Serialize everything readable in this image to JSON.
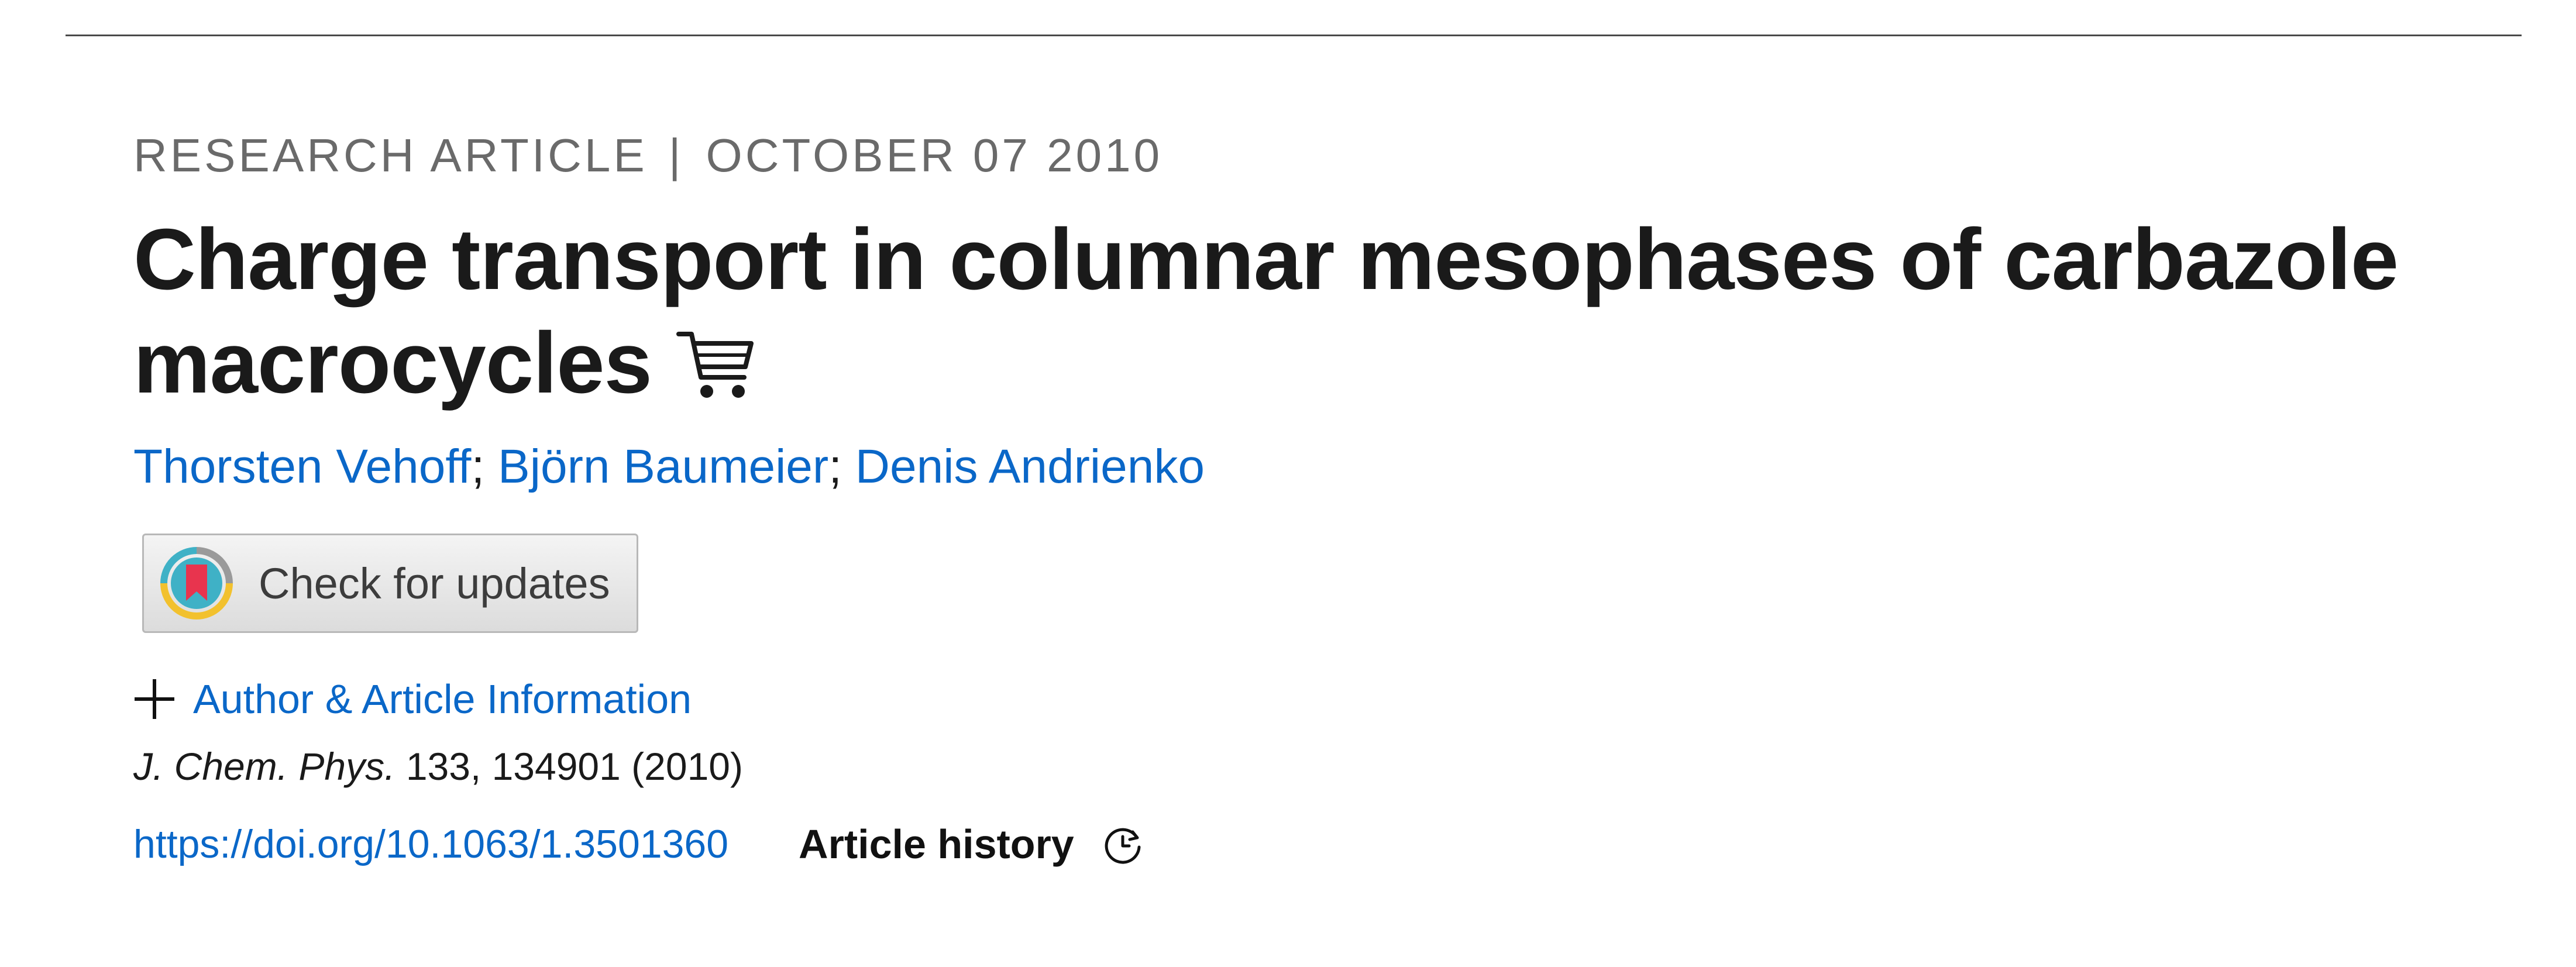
{
  "article": {
    "type": "RESEARCH ARTICLE",
    "separator": "|",
    "date": "OCTOBER 07 2010",
    "title": "Charge transport in columnar mesophases of carbazole macrocycles",
    "title_icon": "shopping-cart-icon",
    "authors": [
      {
        "name": "Thorsten Vehoff"
      },
      {
        "name": "Björn Baumeier"
      },
      {
        "name": "Denis Andrienko"
      }
    ],
    "author_separator": ";",
    "check_updates": {
      "label": "Check for updates",
      "icon": "crossmark-badge-icon"
    },
    "info_toggle": {
      "label": "Author & Article Information",
      "icon": "plus-icon"
    },
    "citation": {
      "journal": "J. Chem. Phys.",
      "details": "133, 134901 (2010)"
    },
    "doi": "https://doi.org/10.1063/1.3501360",
    "history": {
      "label": "Article history",
      "icon": "history-clock-icon"
    }
  },
  "colors": {
    "link": "#0a67c8",
    "kicker": "#6a6a6a",
    "text": "#1a1a1a"
  }
}
